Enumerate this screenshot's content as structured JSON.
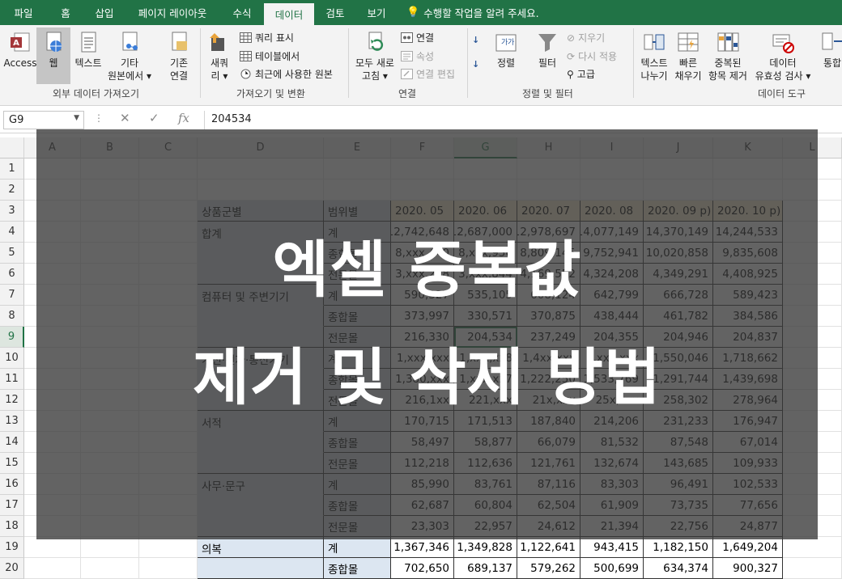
{
  "tabs": [
    "파일",
    "홈",
    "삽입",
    "페이지 레이아웃",
    "수식",
    "데이터",
    "검토",
    "보기"
  ],
  "active_tab": "데이터",
  "tell_me": "수행할 작업을 알려 주세요.",
  "ribbon": {
    "access": "Access",
    "web": "웹",
    "text": "텍스트",
    "other_sources": "기타\n원본에서 ▾",
    "existing_conn": "기존\n연결",
    "new_query": "새쿼\n리 ▾",
    "show_queries": "쿼리 표시",
    "from_table": "테이블에서",
    "recent_sources": "최근에 사용한 원본",
    "refresh_all": "모두 새로\n고침 ▾",
    "connections": "연결",
    "properties": "속성",
    "edit_links": "연결 편집",
    "sort": "정렬",
    "filter": "필터",
    "clear": "지우기",
    "reapply": "다시 적용",
    "advanced": "고급",
    "text_to_columns": "텍스트\n나누기",
    "flash_fill": "빠른\n채우기",
    "remove_duplicates": "중복된\n항목 제거",
    "data_validation": "데이터\n유효성 검사 ▾",
    "consolidate": "통합",
    "groups": {
      "external": "외부 데이터 가져오기",
      "get_transform": "가져오기 및 변환",
      "connections": "연결",
      "sort_filter": "정렬 및 필터",
      "data_tools": "데이터 도구"
    }
  },
  "formula_bar": {
    "name_box": "G9",
    "value": "204534"
  },
  "columns": [
    "A",
    "B",
    "C",
    "D",
    "E",
    "F",
    "G",
    "H",
    "I",
    "J",
    "K",
    "L"
  ],
  "selected_column": "G",
  "rows": [
    "1",
    "2",
    "3",
    "4",
    "5",
    "6",
    "7",
    "8",
    "9",
    "10",
    "11",
    "12",
    "13",
    "14",
    "15",
    "16",
    "17",
    "18",
    "19",
    "20"
  ],
  "selected_row": "9",
  "table": {
    "headers": [
      "상품군별",
      "범위별",
      "2020. 05",
      "2020. 06",
      "2020. 07",
      "2020. 08",
      "2020. 09 p)",
      "2020. 10 p)"
    ],
    "rows": [
      {
        "group": "합계",
        "range": "계",
        "values": [
          "12,742,648",
          "12,687,000",
          "12,978,697",
          "14,077,149",
          "14,370,149",
          "14,244,533"
        ]
      },
      {
        "group": "",
        "range": "종합몰",
        "values": [
          "8,xxx,440",
          "8,xxx,956",
          "8,809,145",
          "9,752,941",
          "10,020,858",
          "9,835,608"
        ]
      },
      {
        "group": "",
        "range": "전문몰",
        "values": [
          "3,xxx,208",
          "3,xxx,844",
          "4,169,552",
          "4,324,208",
          "4,349,291",
          "4,408,925"
        ]
      },
      {
        "group": "컴퓨터 및 주변기기",
        "range": "계",
        "values": [
          "590,327",
          "535,105",
          "608,124",
          "642,799",
          "666,728",
          "589,423"
        ]
      },
      {
        "group": "",
        "range": "종합몰",
        "values": [
          "373,997",
          "330,571",
          "370,875",
          "438,444",
          "461,782",
          "384,586"
        ]
      },
      {
        "group": "",
        "range": "전문몰",
        "values": [
          "216,330",
          "204,534",
          "237,249",
          "204,355",
          "204,946",
          "204,837"
        ]
      },
      {
        "group": "가전·전자·통신기기",
        "range": "계",
        "values": [
          "1,xxx,xxx",
          "1,xxx,xx8",
          "1,4xx,xxx",
          "1,xxx,xxx",
          "1,550,046",
          "1,718,662"
        ]
      },
      {
        "group": "",
        "range": "종합몰",
        "values": [
          "1,380,xxx",
          "1,xxx,xx7",
          "1,222,250",
          "1,533,769",
          "1,291,744",
          "1,439,698"
        ]
      },
      {
        "group": "",
        "range": "전문몰",
        "values": [
          "216,1xx",
          "221,xxx",
          "21x,xxx",
          "25x,xxx",
          "258,302",
          "278,964"
        ]
      },
      {
        "group": "서적",
        "range": "계",
        "values": [
          "170,715",
          "171,513",
          "187,840",
          "214,206",
          "231,233",
          "176,947"
        ]
      },
      {
        "group": "",
        "range": "종합몰",
        "values": [
          "58,497",
          "58,877",
          "66,079",
          "81,532",
          "87,548",
          "67,014"
        ]
      },
      {
        "group": "",
        "range": "전문몰",
        "values": [
          "112,218",
          "112,636",
          "121,761",
          "132,674",
          "143,685",
          "109,933"
        ]
      },
      {
        "group": "사무·문구",
        "range": "계",
        "values": [
          "85,990",
          "83,761",
          "87,116",
          "83,303",
          "96,491",
          "102,533"
        ]
      },
      {
        "group": "",
        "range": "종합몰",
        "values": [
          "62,687",
          "60,804",
          "62,504",
          "61,909",
          "73,735",
          "77,656"
        ]
      },
      {
        "group": "",
        "range": "전문몰",
        "values": [
          "23,303",
          "22,957",
          "24,612",
          "21,394",
          "22,756",
          "24,877"
        ]
      },
      {
        "group": "의복",
        "range": "계",
        "values": [
          "1,367,346",
          "1,349,828",
          "1,122,641",
          "943,415",
          "1,182,150",
          "1,649,204"
        ]
      },
      {
        "group": "",
        "range": "종합몰",
        "values": [
          "702,650",
          "689,137",
          "579,262",
          "500,699",
          "634,374",
          "900,327"
        ]
      }
    ]
  },
  "overlay": {
    "line1": "엑셀 중복값",
    "line2": "제거 및 삭제 방법"
  }
}
